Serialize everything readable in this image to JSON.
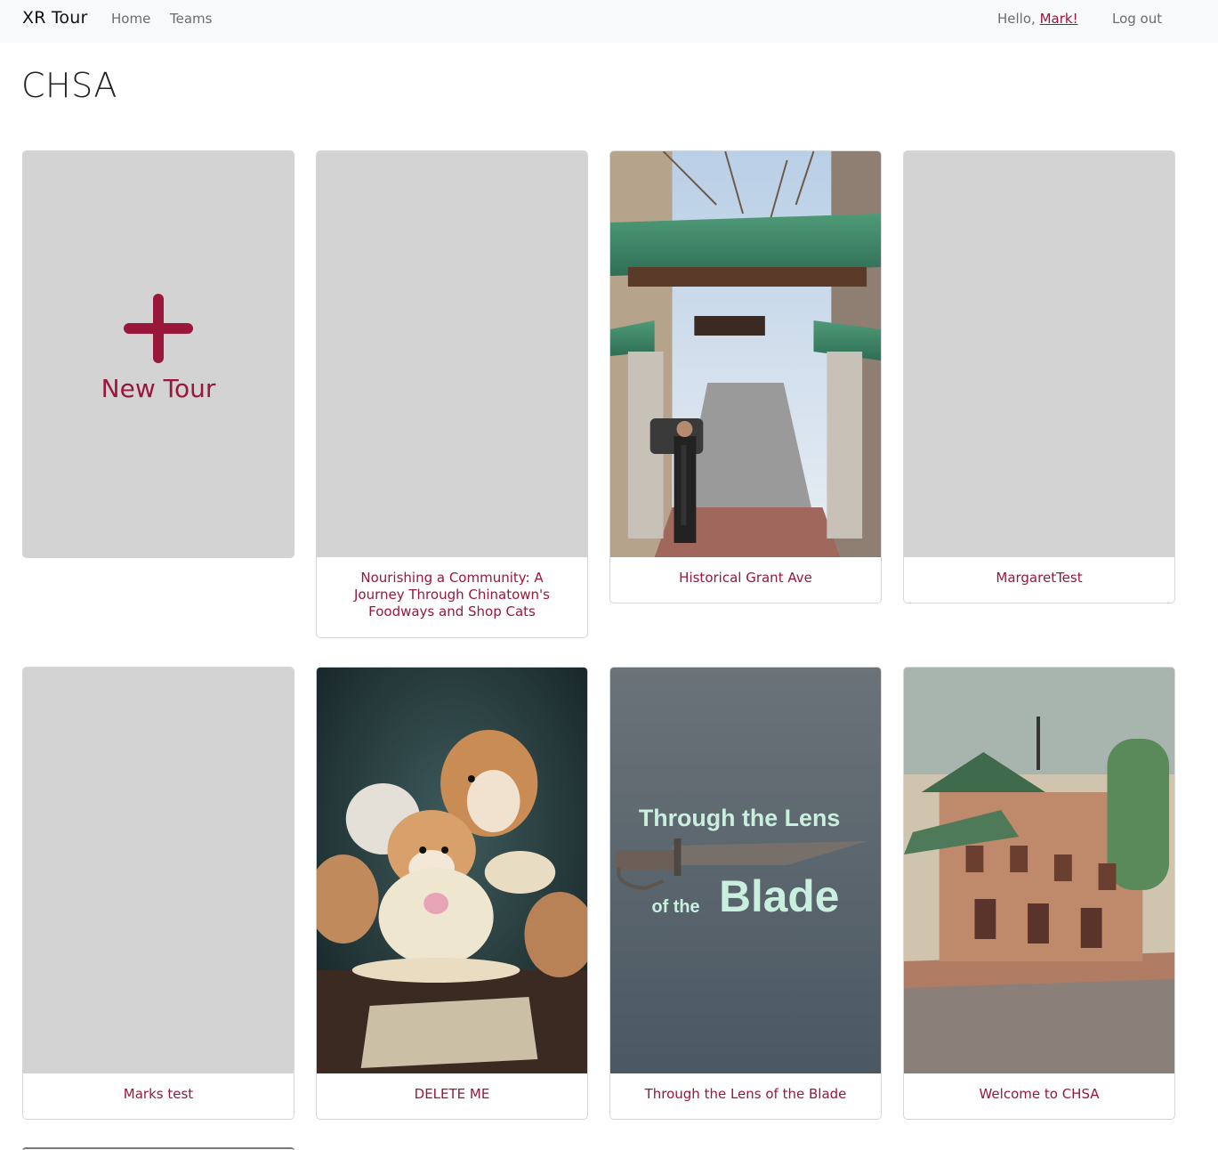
{
  "navbar": {
    "brand": "XR Tour",
    "links": [
      "Home",
      "Teams"
    ],
    "greeting": "Hello,",
    "user": "Mark!",
    "logout": "Log out"
  },
  "page": {
    "title": "CHSA"
  },
  "new_tour": {
    "label": "New Tour",
    "icon": "plus-icon"
  },
  "tours": [
    {
      "title": "Nourishing a Community: A Journey Through Chinatown's Foodways and Shop Cats",
      "image": "none"
    },
    {
      "title": "Historical Grant Ave",
      "image": "chinatown-gate-photo"
    },
    {
      "title": "MargaretTest",
      "image": "none"
    },
    {
      "title": "Marks test",
      "image": "none"
    },
    {
      "title": "DELETE ME",
      "image": "hamsters-tea-party-illustration"
    },
    {
      "title": "Through the Lens of the Blade",
      "image": "blade-poster",
      "poster_text": {
        "line1": "Through the Lens",
        "line2": "of the",
        "line3": "Blade"
      }
    },
    {
      "title": "Welcome to CHSA",
      "image": "watercolor-building-painting"
    }
  ],
  "colors": {
    "accent": "#99173a",
    "placeholder": "#d3d3d3",
    "navbar_bg": "#f8f9fa"
  }
}
